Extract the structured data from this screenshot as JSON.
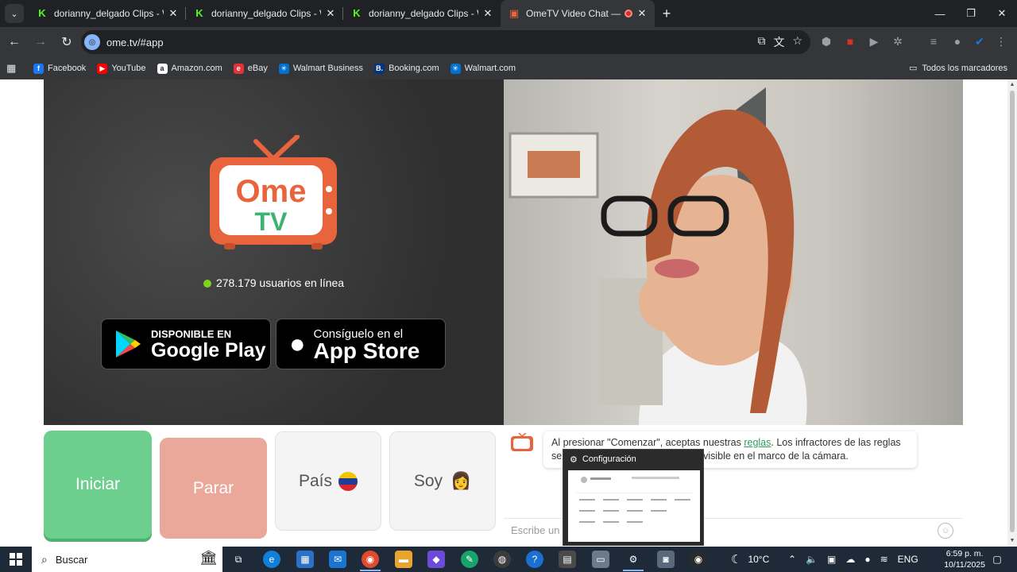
{
  "browser": {
    "tabs": [
      {
        "title": "dorianny_delgado Clips - Watch",
        "active": false
      },
      {
        "title": "dorianny_delgado Clips - Watch",
        "active": false
      },
      {
        "title": "dorianny_delgado Clips - Watch",
        "active": false
      },
      {
        "title": "OmeTV Video Chat — Ome",
        "active": true
      }
    ],
    "url": "ome.tv/#app",
    "bookmarks": [
      {
        "label": "Facebook",
        "icon": "facebook-icon",
        "color": "#1877f2",
        "glyph": "f"
      },
      {
        "label": "YouTube",
        "icon": "youtube-icon",
        "color": "#ff0000",
        "glyph": "▶"
      },
      {
        "label": "Amazon.com",
        "icon": "amazon-icon",
        "color": "#ffffff",
        "glyph": "a"
      },
      {
        "label": "eBay",
        "icon": "ebay-icon",
        "color": "#e53238",
        "glyph": "e"
      },
      {
        "label": "Walmart Business",
        "icon": "walmart-business-icon",
        "color": "#0071ce",
        "glyph": "✳"
      },
      {
        "label": "Booking.com",
        "icon": "booking-icon",
        "color": "#003580",
        "glyph": "B."
      },
      {
        "label": "Walmart.com",
        "icon": "walmart-icon",
        "color": "#0071ce",
        "glyph": "✳"
      }
    ],
    "all_bookmarks": "Todos los marcadores"
  },
  "ometv": {
    "logo_top": "Ome",
    "logo_bottom": "TV",
    "online_text": "278.179 usuarios en línea",
    "google_play": {
      "small": "DISPONIBLE EN",
      "big": "Google Play"
    },
    "app_store": {
      "small": "Consíguelo en el",
      "big": "App Store"
    },
    "start_label": "Iniciar",
    "stop_label": "Parar",
    "country_label": "País",
    "gender_label": "Soy",
    "gender_emoji": "👩",
    "chat_message_before": "Al presionar \"Comenzar\", aceptas nuestras ",
    "chat_message_link": "reglas",
    "chat_message_after": ". Los infractores de las reglas serán baneados. Mantén tu rostro visible en el marco de la cámara.",
    "chat_placeholder": "Escribe un"
  },
  "preview": {
    "title": "Configuración"
  },
  "taskbar": {
    "search": "Buscar",
    "weather": "10°C",
    "language": "ENG",
    "time": "6:59 p. m.",
    "date": "10/11/2025"
  },
  "colors": {
    "accent_green": "#6dcf8e",
    "stop_red": "#eaa89a",
    "ome_orange": "#e8643c",
    "ome_green": "#3cb371"
  }
}
